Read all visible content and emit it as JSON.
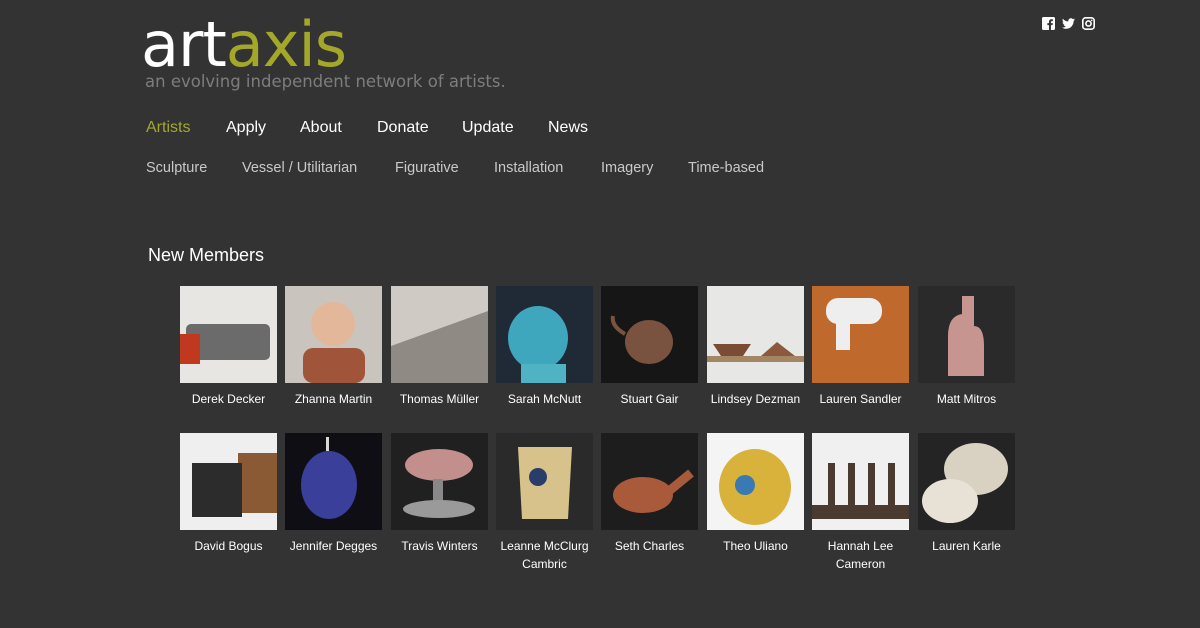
{
  "site": {
    "logo_part1": "art",
    "logo_part2": "axis",
    "tagline": "an evolving independent network of artists."
  },
  "social": [
    {
      "icon": "facebook-icon"
    },
    {
      "icon": "twitter-icon"
    },
    {
      "icon": "instagram-icon"
    }
  ],
  "main_nav": [
    {
      "label": "Artists",
      "active": true
    },
    {
      "label": "Apply"
    },
    {
      "label": "About"
    },
    {
      "label": "Donate"
    },
    {
      "label": "Update"
    },
    {
      "label": "News"
    }
  ],
  "sub_nav": [
    {
      "label": "Sculpture"
    },
    {
      "label": "Vessel / Utilitarian"
    },
    {
      "label": "Figurative"
    },
    {
      "label": "Installation"
    },
    {
      "label": "Imagery"
    },
    {
      "label": "Time-based"
    }
  ],
  "section_title": "New Members",
  "members": [
    {
      "name": "Derek Decker",
      "colors": [
        "#e8e6e2",
        "#6b6b6b"
      ]
    },
    {
      "name": "Zhanna Martin",
      "colors": [
        "#c9c4bd",
        "#a0553b"
      ]
    },
    {
      "name": "Thomas Müller",
      "colors": [
        "#cfcbc4",
        "#8f8a83"
      ]
    },
    {
      "name": "Sarah McNutt",
      "colors": [
        "#1f2a36",
        "#3fa7bd"
      ]
    },
    {
      "name": "Stuart Gair",
      "colors": [
        "#161616",
        "#7a5340"
      ]
    },
    {
      "name": "Lindsey Dezman",
      "colors": [
        "#e7e7e5",
        "#7a4b35"
      ]
    },
    {
      "name": "Lauren Sandler",
      "colors": [
        "#bf6a2c",
        "#eeeeee"
      ]
    },
    {
      "name": "Matt Mitros",
      "colors": [
        "#2a2a2a",
        "#c79590"
      ]
    },
    {
      "name": "David Bogus",
      "colors": [
        "#efefef",
        "#2c2c2c"
      ]
    },
    {
      "name": "Jennifer Degges",
      "colors": [
        "#0e0e14",
        "#3a3f9a"
      ]
    },
    {
      "name": "Travis Winters",
      "colors": [
        "#202020",
        "#c28f8c"
      ]
    },
    {
      "name": "Leanne McClurg Cambric",
      "colors": [
        "#2a2a2a",
        "#d6c28a"
      ]
    },
    {
      "name": "Seth Charles",
      "colors": [
        "#1d1d1d",
        "#a85a3a"
      ]
    },
    {
      "name": "Theo Uliano",
      "colors": [
        "#f4f4f4",
        "#d8b23a"
      ]
    },
    {
      "name": "Hannah Lee Cameron",
      "colors": [
        "#f0f0f0",
        "#4a3a30"
      ]
    },
    {
      "name": "Lauren Karle",
      "colors": [
        "#242424",
        "#d9d2c3"
      ]
    }
  ],
  "colors": {
    "background": "#333333",
    "accent": "#a3a829",
    "tagline": "#7d7d7d",
    "subnav": "#c9c9c9"
  }
}
